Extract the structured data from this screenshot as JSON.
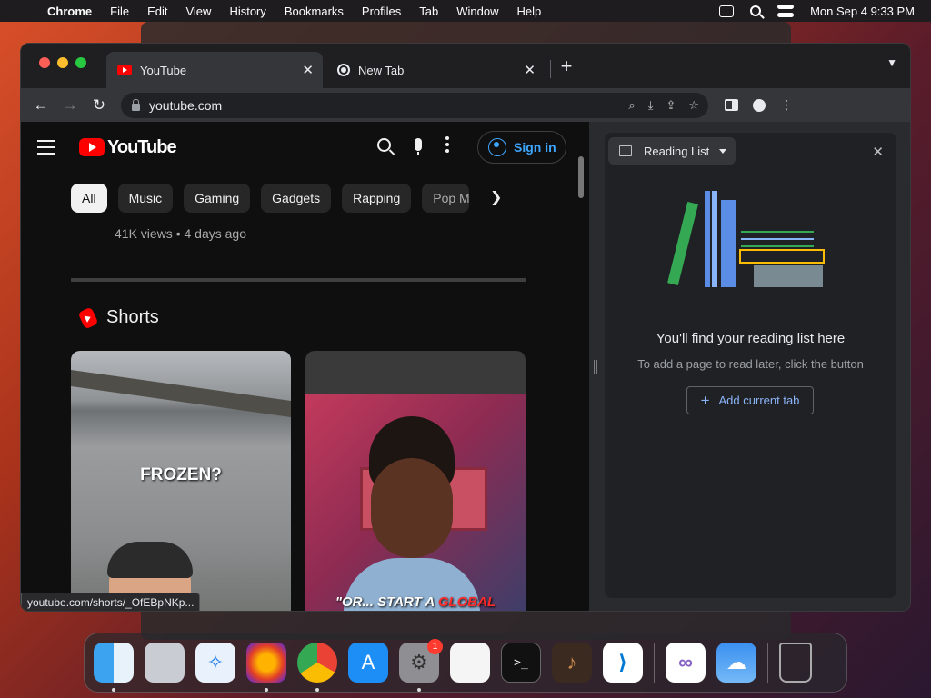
{
  "menubar": {
    "app": "Chrome",
    "items": [
      "File",
      "Edit",
      "View",
      "History",
      "Bookmarks",
      "Profiles",
      "Tab",
      "Window",
      "Help"
    ],
    "clock": "Mon Sep 4  9:33 PM"
  },
  "tabs": [
    {
      "title": "YouTube",
      "icon": "youtube-favicon-icon"
    },
    {
      "title": "New Tab",
      "icon": "chrome-favicon-icon"
    }
  ],
  "omnibox": {
    "url": "youtube.com"
  },
  "youtube": {
    "logo_text": "YouTube",
    "signin_label": "Sign in",
    "chips": [
      "All",
      "Music",
      "Gaming",
      "Gadgets",
      "Rapping",
      "Pop M"
    ],
    "video_meta": "41K views • 4 days ago",
    "shorts_title": "Shorts",
    "shorts": [
      {
        "caption": "FROZEN?"
      },
      {
        "caption_prefix": "\"OR... START A ",
        "caption_highlight": "GLOBAL"
      }
    ],
    "status_url": "youtube.com/shorts/_OfEBpNKp..."
  },
  "side_panel": {
    "selector_label": "Reading List",
    "empty_title": "You'll find your reading list here",
    "empty_subtitle": "To add a page to read later, click the button",
    "add_button": "Add current tab"
  },
  "dock": {
    "apps": [
      "Finder",
      "Launchpad",
      "Safari",
      "Firefox",
      "Chrome",
      "App Store",
      "System Settings",
      "TextEdit",
      "Terminal",
      "GarageBand",
      "VS Code",
      "Visual Studio",
      "Weather",
      "Trash"
    ],
    "settings_badge": "1"
  },
  "colors": {
    "yt_red": "#ff0000",
    "link_blue": "#3ea6ff",
    "chrome_blue": "#8ab4f8"
  }
}
